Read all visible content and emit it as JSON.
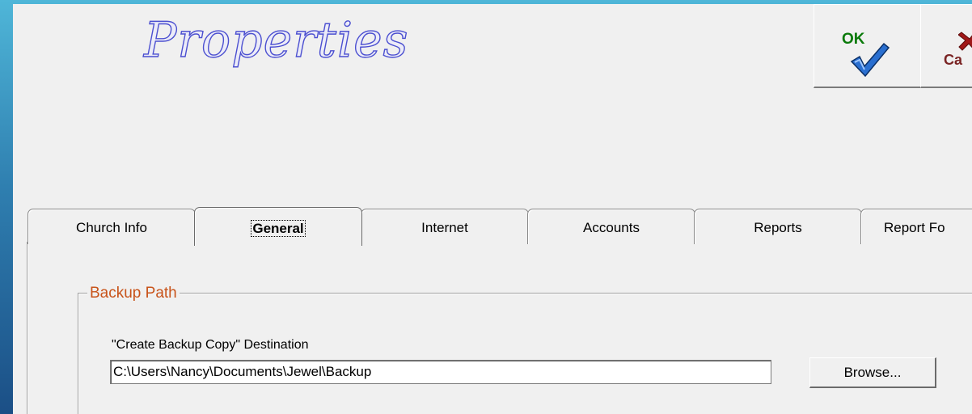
{
  "window": {
    "title": "Properties"
  },
  "toolbar": {
    "ok_label": "OK",
    "cancel_label": "Ca"
  },
  "tabs": [
    {
      "label": "Church Info",
      "active": false
    },
    {
      "label": "General",
      "active": true
    },
    {
      "label": "Internet",
      "active": false
    },
    {
      "label": "Accounts",
      "active": false
    },
    {
      "label": "Reports",
      "active": false
    },
    {
      "label": "Report Fo",
      "active": false
    }
  ],
  "general": {
    "backup_group": {
      "title": "Backup Path",
      "destination_label": "\"Create Backup Copy\" Destination",
      "path_value": "C:\\Users\\Nancy\\Documents\\Jewel\\Backup",
      "browse_label": "Browse..."
    }
  },
  "colors": {
    "title_outline": "#4b4fd0",
    "group_title": "#c8531a",
    "ok_text": "#0a7a0a",
    "check_mark": "#2a6fd0"
  },
  "icons": [
    "check-icon",
    "cancel-x-icon"
  ]
}
